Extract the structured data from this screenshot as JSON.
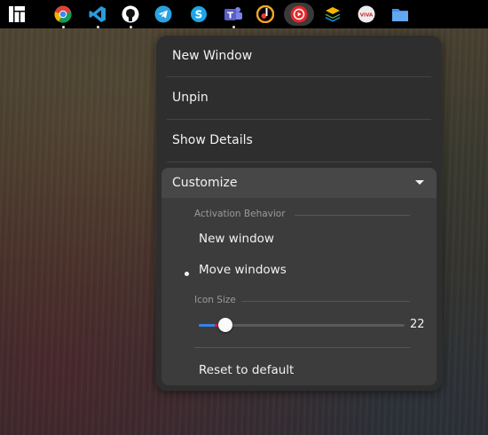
{
  "dock": {
    "apps": [
      {
        "icon": "manjaro-icon",
        "glyph": "",
        "color": "#ffffff"
      },
      {
        "icon": "chrome-icon",
        "glyph": "",
        "color": "#e8453c"
      },
      {
        "icon": "vscode-icon",
        "glyph": "",
        "color": "#1f8ad2"
      },
      {
        "icon": "github-icon",
        "glyph": "",
        "color": "#ffffff"
      },
      {
        "icon": "telegram-icon",
        "glyph": "",
        "color": "#2aa3df"
      },
      {
        "icon": "skype-icon",
        "glyph": "S",
        "color": "#1ea4e8"
      },
      {
        "icon": "teams-icon",
        "glyph": "T",
        "color": "#5b5fc7"
      },
      {
        "icon": "music-icon",
        "glyph": "",
        "color": "#f5a623"
      },
      {
        "icon": "youtube-music-icon",
        "glyph": "",
        "color": "#e2282c"
      },
      {
        "icon": "layers-icon",
        "glyph": "",
        "color": "#4caf50"
      },
      {
        "icon": "vivaldi-icon",
        "glyph": "VIVA",
        "color": "#ececec"
      },
      {
        "icon": "files-icon",
        "glyph": "",
        "color": "#3d8ee8"
      }
    ]
  },
  "menu": {
    "new_window": "New Window",
    "unpin": "Unpin",
    "show_details": "Show Details",
    "customize": "Customize",
    "activation_behavior_label": "Activation Behavior",
    "activation_options": [
      "New window",
      "Move windows"
    ],
    "selected_activation": "Move windows",
    "icon_size_label": "Icon Size",
    "icon_size_value": "22",
    "icon_size_fraction": 0.13,
    "reset": "Reset to default"
  },
  "colors": {
    "accent": "#3584e4",
    "menu_bg": "#2e2e2e"
  }
}
